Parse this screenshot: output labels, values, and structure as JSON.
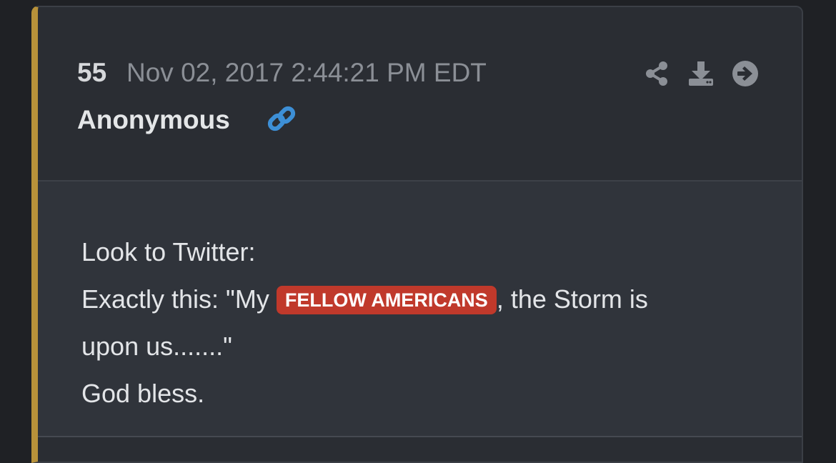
{
  "post": {
    "number": "55",
    "timestamp": "Nov 02, 2017 2:44:21 PM EDT",
    "author": "Anonymous",
    "accent_color": "#b8923a",
    "actions": [
      {
        "icon": "share-icon"
      },
      {
        "icon": "download-icon"
      },
      {
        "icon": "arrow-circle-right-icon"
      }
    ],
    "link_icon": "link-icon"
  },
  "message": {
    "line1": "Look to Twitter:",
    "line2_prefix": "Exactly this: \"My ",
    "tag": "FELLOW AMERICANS",
    "tag_color": "#c0392b",
    "line2_suffix": ", the Storm is",
    "line3": "upon us.......\"",
    "line4": "God bless."
  }
}
